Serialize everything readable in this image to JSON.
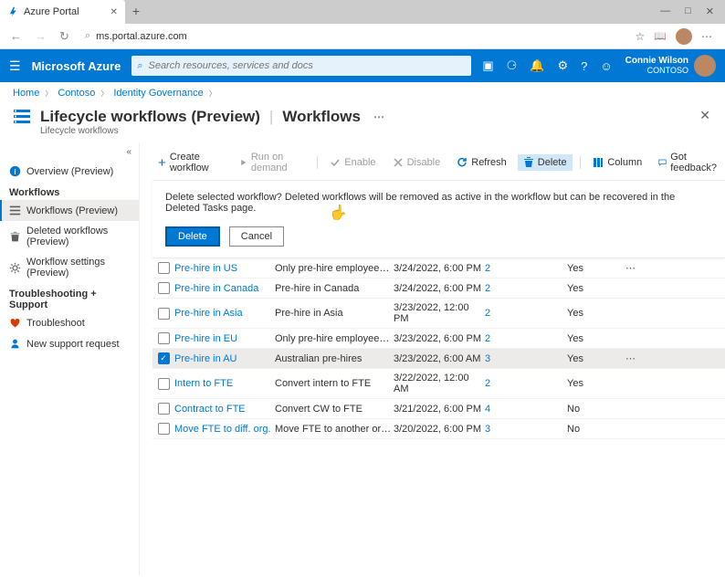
{
  "browser": {
    "tab_title": "Azure Portal",
    "url": "ms.portal.azure.com"
  },
  "topbar": {
    "brand": "Microsoft Azure",
    "search_placeholder": "Search resources, services and docs",
    "user_name": "Connie Wilson",
    "user_org": "CONTOSO"
  },
  "breadcrumb": [
    "Home",
    "Contoso",
    "Identity Governance"
  ],
  "page": {
    "title_left": "Lifecycle workflows (Preview)",
    "title_right": "Workflows",
    "subtitle": "Lifecycle workflows"
  },
  "sidebar": {
    "overview": "Overview (Preview)",
    "section_workflows": "Workflows",
    "workflows": "Workflows (Preview)",
    "deleted": "Deleted workflows (Preview)",
    "settings": "Workflow settings (Preview)",
    "section_support": "Troubleshooting + Support",
    "troubleshoot": "Troubleshoot",
    "new_request": "New support request"
  },
  "toolbar": {
    "create": "Create workflow",
    "run": "Run on demand",
    "enable": "Enable",
    "disable": "Disable",
    "refresh": "Refresh",
    "delete": "Delete",
    "column": "Column",
    "feedback": "Got feedback?"
  },
  "banner": {
    "message": "Delete selected workflow? Deleted workflows will be removed as active in the workflow but can be recovered in the Deleted Tasks page.",
    "confirm": "Delete",
    "cancel": "Cancel"
  },
  "workflows": [
    {
      "name": "Pre-hire in US",
      "desc": "Only pre-hire employees in the USA",
      "date": "3/24/2022, 6:00 PM",
      "num": "2",
      "active": "Yes",
      "checked": false
    },
    {
      "name": "Pre-hire in Canada",
      "desc": "Pre-hire in Canada",
      "date": "3/24/2022, 6:00 PM",
      "num": "2",
      "active": "Yes",
      "checked": false
    },
    {
      "name": "Pre-hire in Asia",
      "desc": "Pre-hire in Asia",
      "date": "3/23/2022, 12:00 PM",
      "num": "2",
      "active": "Yes",
      "checked": false
    },
    {
      "name": "Pre-hire in EU",
      "desc": "Only pre-hire employees in Europe...",
      "date": "3/23/2022, 6:00 PM",
      "num": "2",
      "active": "Yes",
      "checked": false
    },
    {
      "name": "Pre-hire in AU",
      "desc": "Australian pre-hires",
      "date": "3/23/2022, 6:00 AM",
      "num": "3",
      "active": "Yes",
      "checked": true
    },
    {
      "name": "Intern to FTE",
      "desc": "Convert intern to FTE",
      "date": "3/22/2022, 12:00 AM",
      "num": "2",
      "active": "Yes",
      "checked": false
    },
    {
      "name": "Contract to FTE",
      "desc": "Convert CW to FTE",
      "date": "3/21/2022, 6:00 PM",
      "num": "4",
      "active": "No",
      "checked": false
    },
    {
      "name": "Move FTE to diff. org.",
      "desc": "Move FTE to another organization",
      "date": "3/20/2022, 6:00 PM",
      "num": "3",
      "active": "No",
      "checked": false
    }
  ]
}
